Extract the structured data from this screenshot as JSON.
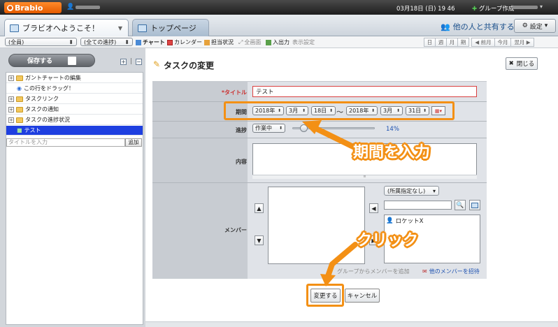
{
  "topbar": {
    "brand": "Brabio",
    "datetime": "03月18日 (日) 19 46",
    "group_create": "グループ作成"
  },
  "tabs": {
    "tab1": "ブラビオへようこそ！",
    "tab2": "トップページ",
    "share": "他の人と共有する",
    "settings": "設定"
  },
  "toolbar": {
    "members_select": "(全員)",
    "progress_select": "(全ての進捗)",
    "chart": "チャート",
    "calendar": "カレンダー",
    "status": "担当状況",
    "fullscreen": "全画面",
    "io": "入出力",
    "display_settings": "表示設定",
    "view_buttons": [
      "日",
      "週",
      "月",
      "期",
      "◀ 前月",
      "今月",
      "翌月 ▶"
    ]
  },
  "sidebar": {
    "save_button": "保存する",
    "tree": [
      {
        "label": "ガントチャートの編集",
        "type": "folder",
        "expander": "+"
      },
      {
        "label": "この行をドラッグ！",
        "type": "item",
        "expander": ""
      },
      {
        "label": "タスクリンク",
        "type": "folder",
        "expander": "+"
      },
      {
        "label": "タスクの通知",
        "type": "folder",
        "expander": "+"
      },
      {
        "label": "タスクの進捗状況",
        "type": "folder",
        "expander": "+"
      },
      {
        "label": "テスト",
        "type": "selected",
        "expander": ""
      }
    ],
    "new_placeholder": "タイトルを入力",
    "add_button": "追加"
  },
  "dialog": {
    "title": "タスクの変更",
    "close_button": "閉じる",
    "labels": {
      "title": "*タイトル",
      "period": "期間",
      "progress": "進捗",
      "content": "内容",
      "members": "メンバー"
    },
    "title_value": "テスト",
    "period": {
      "start_year": "2018年",
      "start_month": "3月",
      "start_day": "18日",
      "tilde": "〜",
      "end_year": "2018年",
      "end_month": "3月",
      "end_day": "31日"
    },
    "progress_select": "作業中",
    "progress_value": 0.14,
    "progress_text": "14%",
    "unassigned_select": "(所属指定なし)",
    "candidate": "ロケットX",
    "from_group": "グループからメンバーを追加",
    "invite": "他のメンバーを招待",
    "change_button": "変更する",
    "cancel_button": "キャンセル"
  },
  "callouts": {
    "period": "期間を入力",
    "click": "クリック"
  },
  "colors": {
    "accent_orange": "#f39015",
    "selected_row": "#1e3fe0",
    "link_blue": "#1a4fb0"
  }
}
